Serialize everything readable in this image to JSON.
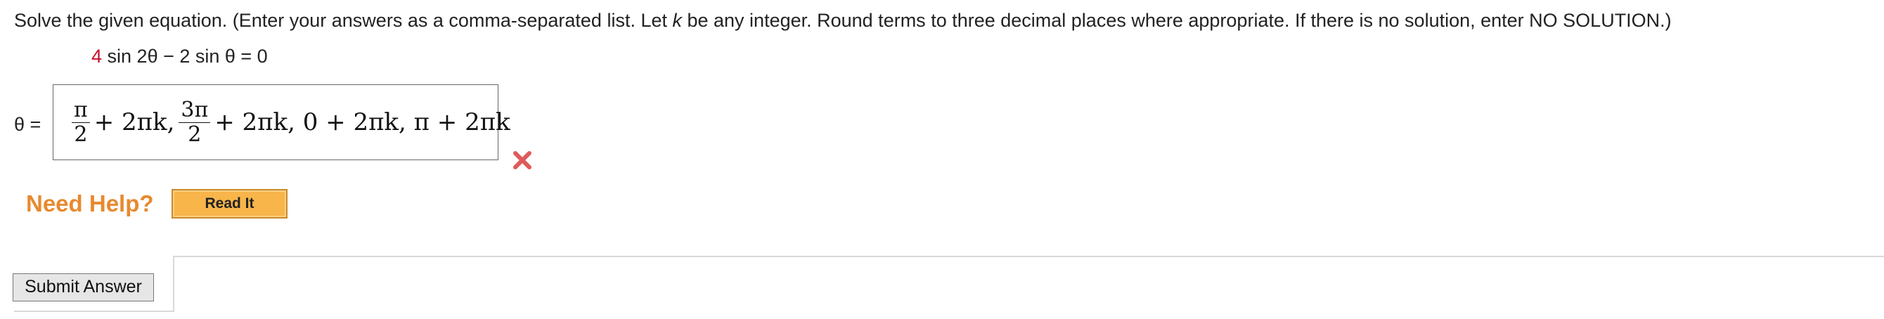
{
  "question": {
    "instructions_pre": "Solve the given equation. (Enter your answers as a comma-separated list. Let ",
    "instructions_var": "k",
    "instructions_post": " be any integer. Round terms to three decimal places where appropriate. If there is no solution, enter NO SOLUTION.)",
    "equation_coef": "4",
    "equation_rest": " sin 2θ − 2 sin θ = 0"
  },
  "answer": {
    "variable_label": "θ =",
    "term1_num": "π",
    "term1_den": "2",
    "term1_suffix": "+ 2πk,",
    "term2_num": "3π",
    "term2_den": "2",
    "term2_suffix": "+ 2πk, 0 + 2πk, π + 2πk",
    "status_icon": "wrong-x-icon",
    "status_color": "#e05a5a"
  },
  "help": {
    "label": "Need Help?",
    "read_it_label": "Read It",
    "label_color": "#e8892f",
    "button_color": "#f7b54a"
  },
  "footer": {
    "submit_label": "Submit Answer"
  }
}
